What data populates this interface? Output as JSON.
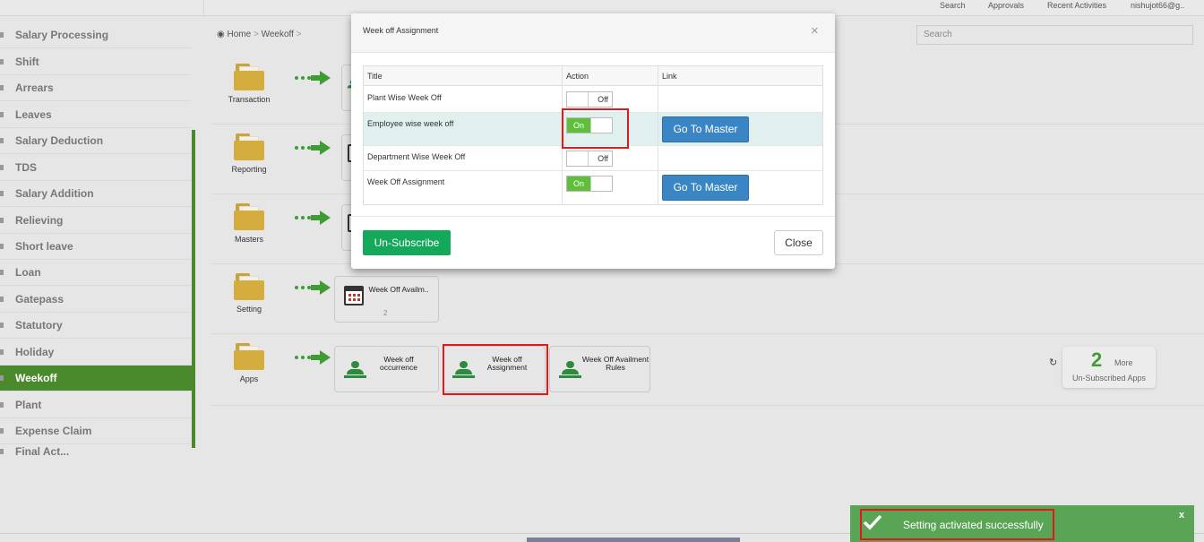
{
  "topbar": {
    "links": [
      "Search",
      "Approvals",
      "Recent Activities",
      "nishujot66@g.."
    ]
  },
  "sidebar": {
    "items": [
      "Salary Processing",
      "Shift",
      "Arrears",
      "Leaves",
      "Salary Deduction",
      "TDS",
      "Salary Addition",
      "Relieving",
      "Short leave",
      "Loan",
      "Gatepass",
      "Statutory",
      "Holiday",
      "Weekoff",
      "Plant",
      "Expense Claim",
      "Final Act..."
    ],
    "active": "Weekoff"
  },
  "breadcrumb": {
    "home": "Home",
    "current": "Weekoff",
    "sep": ">"
  },
  "search": {
    "placeholder": "Search"
  },
  "rows": [
    {
      "label": "Transaction"
    },
    {
      "label": "Reporting"
    },
    {
      "label": "Masters"
    },
    {
      "label": "Setting",
      "cards": [
        {
          "title": "Week Off Availm..",
          "count": "2"
        }
      ]
    },
    {
      "label": "Apps",
      "cards": [
        {
          "title": "Week off occurrence"
        },
        {
          "title": "Week off Assignment"
        },
        {
          "title": "Week Off Availment Rules"
        }
      ]
    }
  ],
  "more": {
    "count": "2",
    "word": "More",
    "sub": "Un-Subscribed Apps"
  },
  "modal": {
    "title": "Week off Assignment",
    "columns": [
      "Title",
      "Action",
      "Link"
    ],
    "rows": [
      {
        "title": "Plant Wise Week Off",
        "state": "Off",
        "link": ""
      },
      {
        "title": "Employee wise week off",
        "state": "On",
        "link": "Go To Master"
      },
      {
        "title": "Department Wise Week Off",
        "state": "Off",
        "link": ""
      },
      {
        "title": "Week Off Assignment",
        "state": "On",
        "link": "Go To Master"
      }
    ],
    "unsubscribe": "Un-Subscribe",
    "close": "Close"
  },
  "toast": {
    "message": "Setting activated successfully",
    "close": "x"
  },
  "colors": {
    "accent_green": "#4a8a2c",
    "toggle_on": "#5fbf3a",
    "master_blue": "#3a86c4",
    "unsub_green": "#13a85a",
    "toast_green": "#59a455",
    "highlight_red": "#e31818"
  }
}
